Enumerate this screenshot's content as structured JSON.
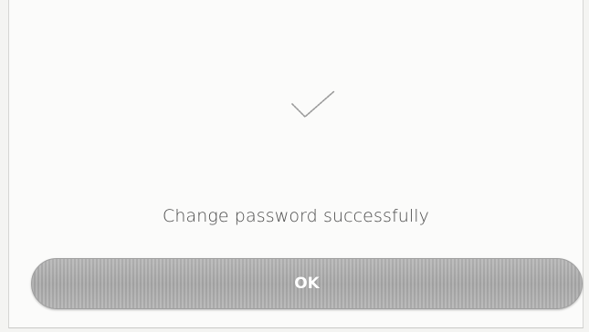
{
  "dialog": {
    "icon": "checkmark-icon",
    "message": "Change password successfully",
    "ok_label": "OK"
  },
  "colors": {
    "button_bg": "#ababab",
    "button_text": "#ffffff",
    "message_text": "#4a4a4a",
    "icon_stroke": "#9a9a9a"
  }
}
